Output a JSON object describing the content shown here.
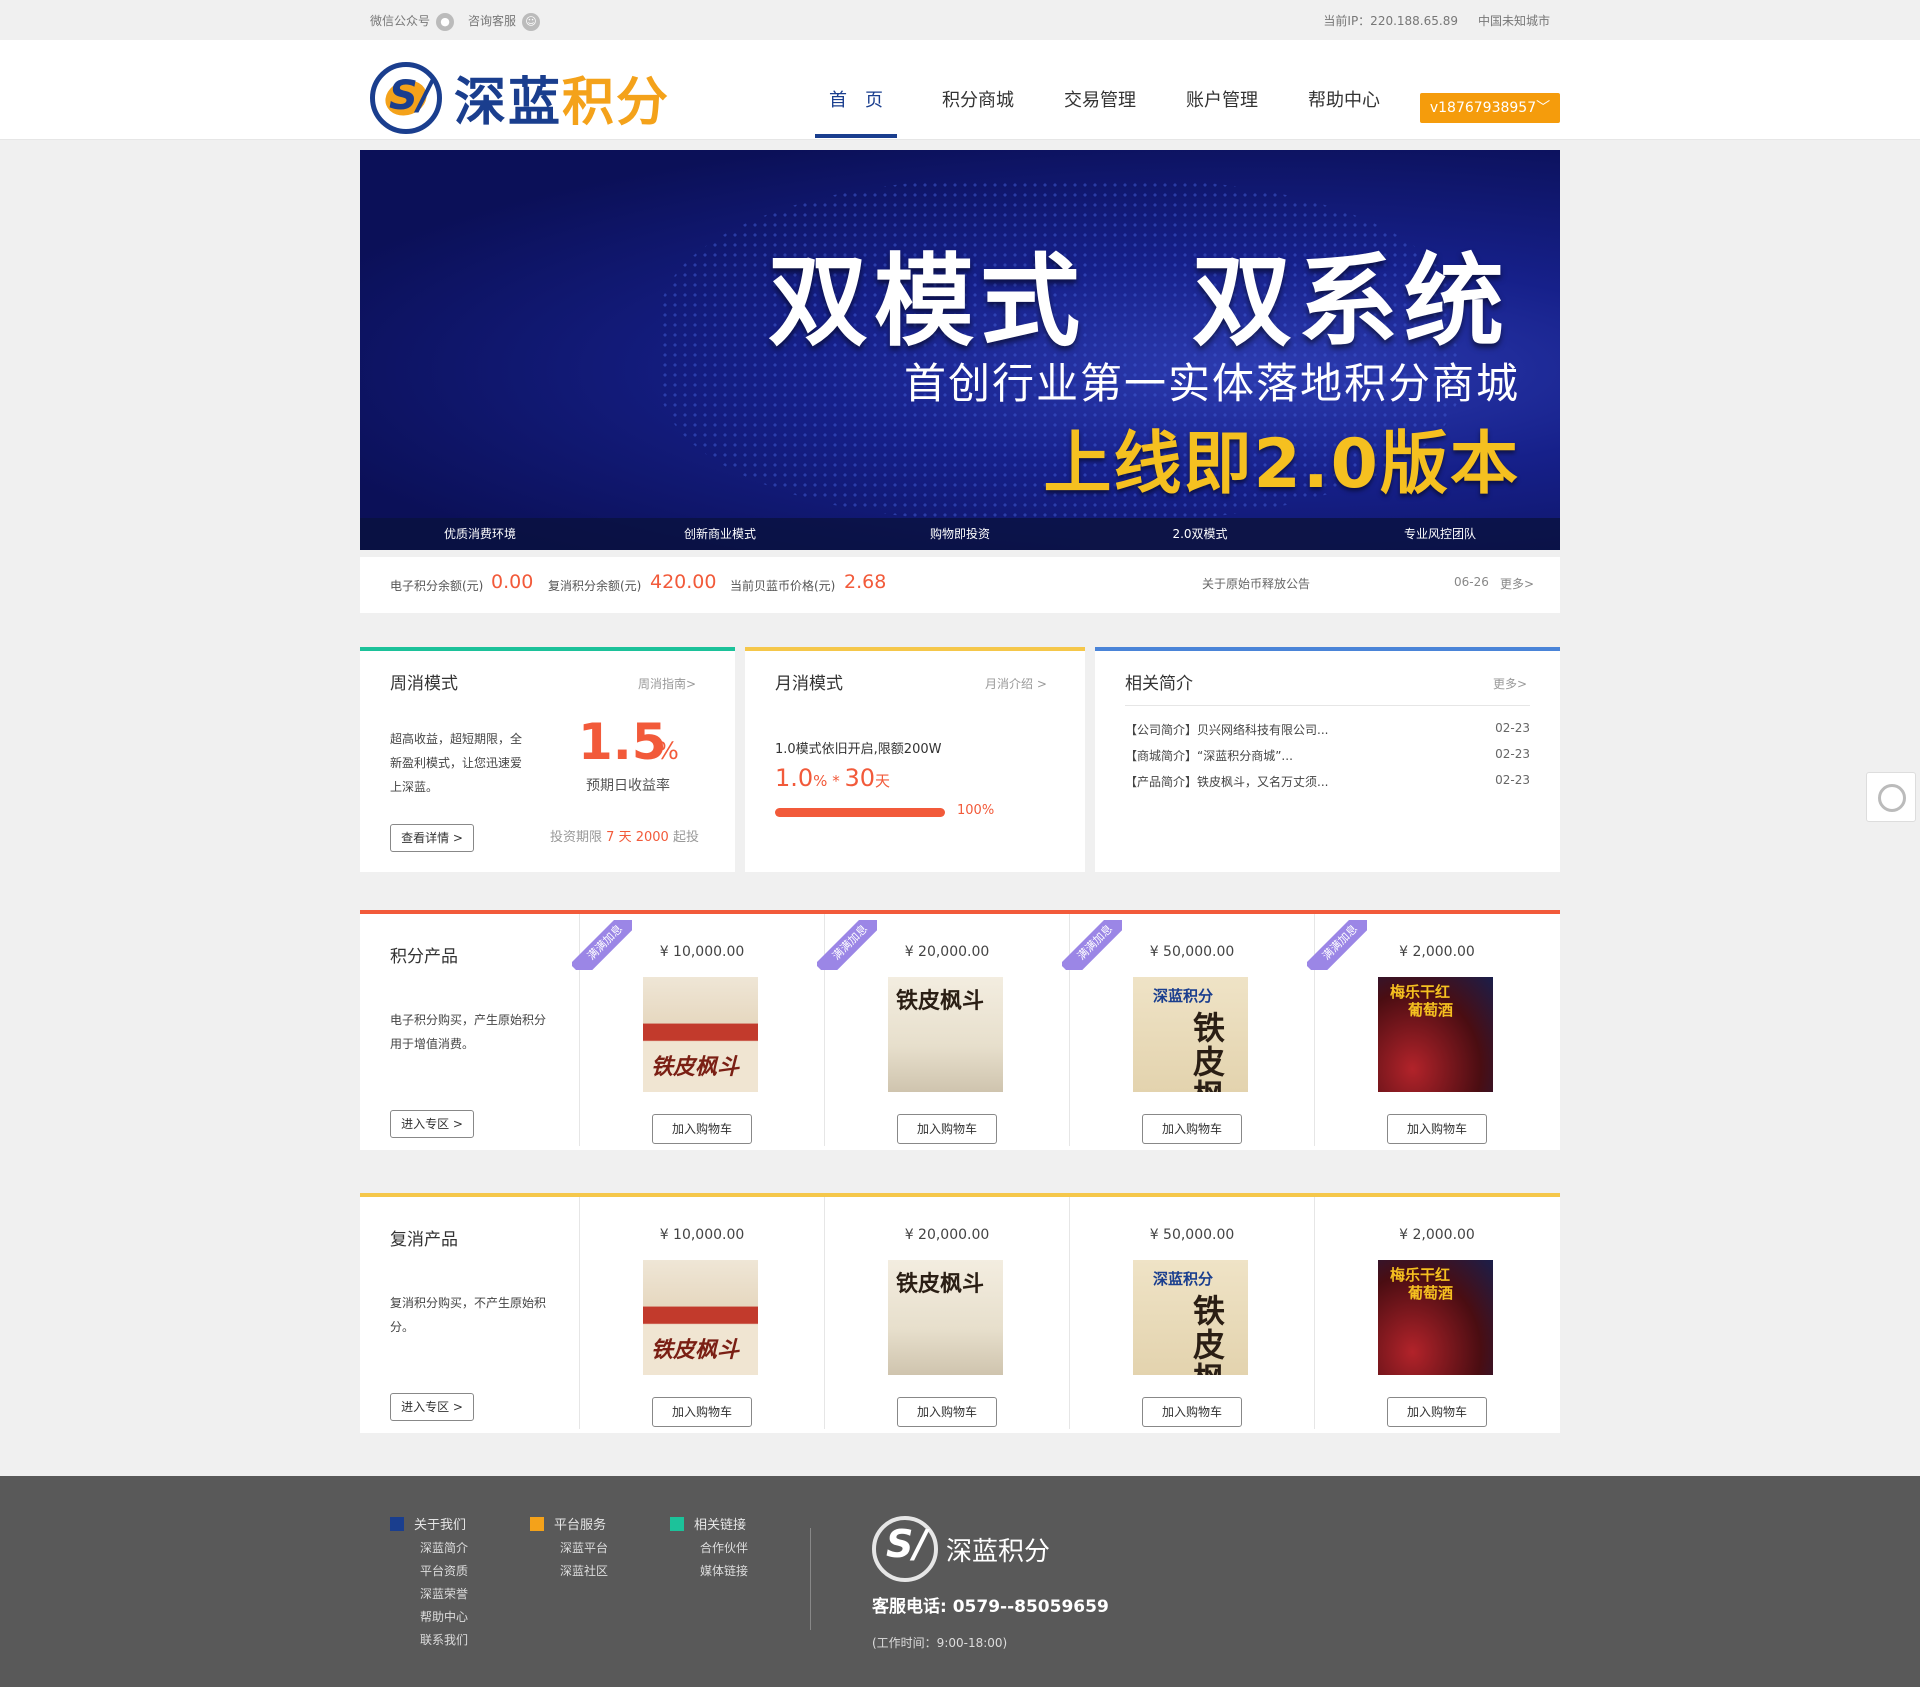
{
  "topbar": {
    "wechat": "微信公众号",
    "service": "咨询客服",
    "ip": "当前IP：220.188.65.89",
    "city": "中国未知城市"
  },
  "logo": {
    "part1": "深蓝",
    "part2": "积分"
  },
  "nav": [
    "首　页",
    "积分商城",
    "交易管理",
    "账户管理",
    "帮助中心"
  ],
  "user": "v18767938957",
  "banner": {
    "title": "双模式　双系统",
    "subtitle": "首创行业第一实体落地积分商城",
    "highlight": "上线即2.0版本",
    "tabs": [
      "优质消费环境",
      "创新商业模式",
      "购物即投资",
      "2.0双模式",
      "专业风控团队"
    ]
  },
  "info": {
    "e_label": "电子积分余额(元)",
    "e_value": "0.00",
    "f_label": "复消积分余额(元)",
    "f_value": "420.00",
    "p_label": "当前贝蓝币价格(元)",
    "p_value": "2.68",
    "notice": "关于原始币释放公告",
    "date": "06-26",
    "more": "更多>"
  },
  "weekly": {
    "title": "周消模式",
    "link": "周消指南>",
    "desc": "超高收益，超短期限，全新盈利模式，让您迅速爱上深蓝。",
    "rate": "1.5",
    "unit": "%",
    "rate_label": "预期日收益率",
    "btn": "查看详情 >",
    "term_a": "投资期限",
    "term_days": "7",
    "term_unit": "天",
    "term_amt": "2000",
    "term_b": "起投"
  },
  "monthly": {
    "title": "月消模式",
    "link": "月消介绍 >",
    "line1": "1.0模式依旧开启,限额200W",
    "rate": "1.0",
    "pct": "%",
    "times": " * ",
    "days": "30",
    "day_unit": "天",
    "progress": 100,
    "progress_label": "100%"
  },
  "about": {
    "title": "相关简介",
    "link": "更多>",
    "rows": [
      {
        "text": "【公司简介】贝兴网络科技有限公司...",
        "date": "02-23"
      },
      {
        "text": "【商城简介】“深蓝积分商城”...",
        "date": "02-23"
      },
      {
        "text": "【产品简介】铁皮枫斗，又名万丈须...",
        "date": "02-23"
      }
    ]
  },
  "points": {
    "title": "积分产品",
    "desc": "电子积分购买，产生原始积分用于增值消费。",
    "btn": "进入专区 >",
    "ribbon": "满满加息",
    "cart": "加入购物车",
    "prices": [
      "¥ 10,000.00",
      "¥ 20,000.00",
      "¥ 50,000.00",
      "¥ 2,000.00"
    ]
  },
  "repeat": {
    "title": "复消产品",
    "desc": "复消积分购买，不产生原始积分。",
    "btn": "进入专区 >",
    "cart": "加入购物车",
    "prices": [
      "¥ 10,000.00",
      "¥ 20,000.00",
      "¥ 50,000.00",
      "¥ 2,000.00"
    ]
  },
  "product_labels": {
    "tea": "铁皮枫斗",
    "brand": "深蓝积分",
    "tea_v": "铁皮枫斗",
    "wine1": "梅乐干红",
    "wine2": "葡萄酒"
  },
  "footer": {
    "about": {
      "title": "关于我们",
      "items": [
        "深蓝简介",
        "平台资质",
        "深蓝荣誉",
        "帮助中心",
        "联系我们"
      ]
    },
    "service": {
      "title": "平台服务",
      "items": [
        "深蓝平台",
        "深蓝社区"
      ]
    },
    "links": {
      "title": "相关链接",
      "items": [
        "合作伙伴",
        "媒体链接"
      ]
    },
    "brand": "深蓝积分",
    "phone": "客服电话: 0579--85059659",
    "hours": "(工作时间：9:00-18:00)"
  },
  "colors": {
    "brand": "#1a3e8e",
    "accent": "#f4a21a",
    "red": "#f25a3a",
    "green": "#1cc29a",
    "yellow": "#f5c74a",
    "blue": "#4a84d8"
  }
}
